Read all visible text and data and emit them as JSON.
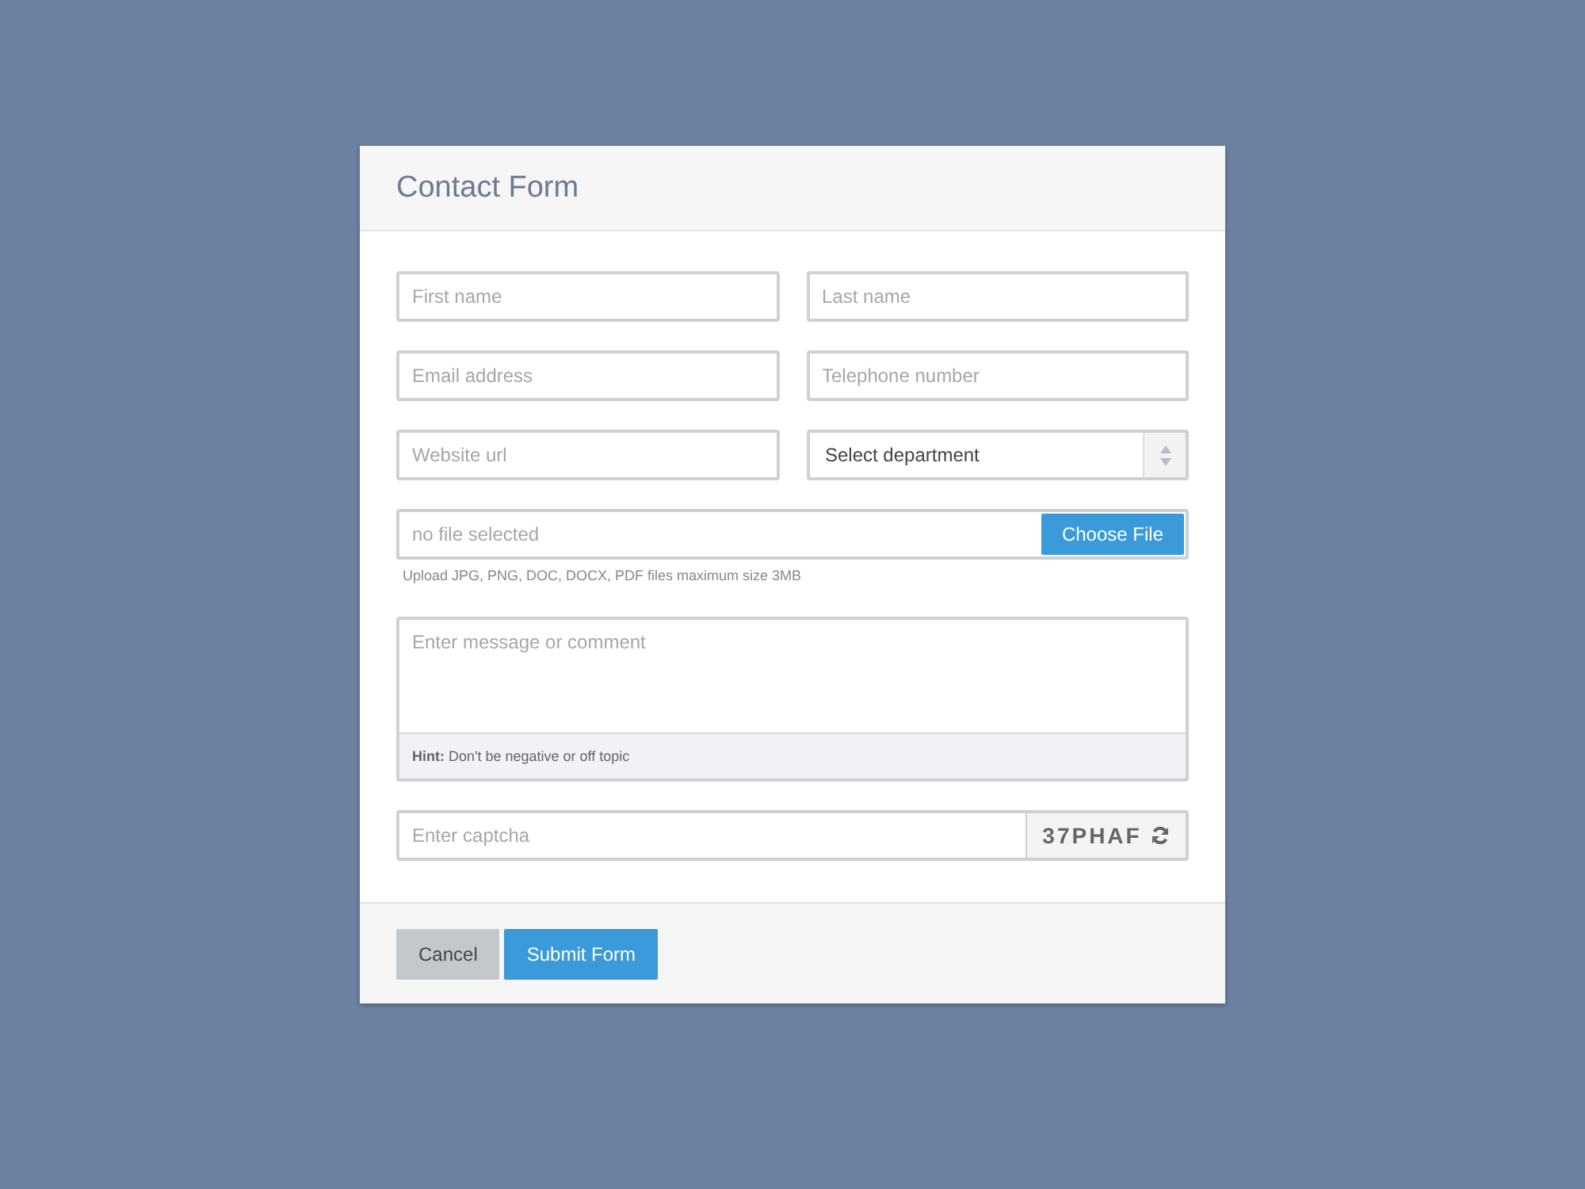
{
  "window": {
    "title": "Contact Form"
  },
  "fields": [
    {
      "placeholder": "First name"
    },
    {
      "placeholder": "Last name"
    },
    {
      "placeholder": "Email address"
    },
    {
      "placeholder": "Telephone number"
    },
    {
      "placeholder": "Website url"
    }
  ],
  "department_select": {
    "value": "Select department"
  },
  "file_upload": {
    "status": "no file selected",
    "button": "Choose File",
    "help": "Upload JPG, PNG, DOC, DOCX, PDF files maximum size 3MB"
  },
  "message": {
    "placeholder": "Enter message or comment",
    "hint": "**Hint:** Don't be negative or off topic"
  },
  "captcha": {
    "placeholder": "Enter captcha",
    "code": "37PHAF"
  },
  "buttons": [
    {
      "kind": "secondary",
      "label": "Cancel"
    },
    {
      "kind": "primary",
      "label": "Submit Form"
    }
  ]
}
